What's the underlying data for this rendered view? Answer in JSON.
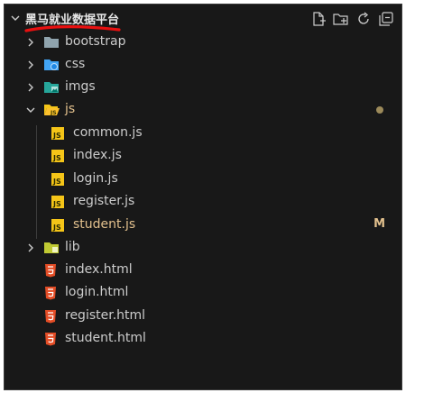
{
  "explorer": {
    "project_title": "黑马就业数据平台",
    "actions": [
      "new-file-icon",
      "new-folder-icon",
      "refresh-icon",
      "collapse-all-icon"
    ],
    "items": [
      {
        "label": "bootstrap",
        "kind": "folder",
        "expanded": false,
        "icon": "folder-icon"
      },
      {
        "label": "css",
        "kind": "folder",
        "expanded": false,
        "icon": "css-folder-icon"
      },
      {
        "label": "imgs",
        "kind": "folder",
        "expanded": false,
        "icon": "images-folder-icon"
      },
      {
        "label": "js",
        "kind": "folder",
        "expanded": true,
        "icon": "js-folder-icon",
        "status": "modified-dot"
      },
      {
        "label": "common.js",
        "kind": "file",
        "icon": "js-file-icon",
        "badge": "JS"
      },
      {
        "label": "index.js",
        "kind": "file",
        "icon": "js-file-icon",
        "badge": "JS"
      },
      {
        "label": "login.js",
        "kind": "file",
        "icon": "js-file-icon",
        "badge": "JS"
      },
      {
        "label": "register.js",
        "kind": "file",
        "icon": "js-file-icon",
        "badge": "JS"
      },
      {
        "label": "student.js",
        "kind": "file",
        "icon": "js-file-icon",
        "badge": "JS",
        "git_status": "M"
      },
      {
        "label": "lib",
        "kind": "folder",
        "expanded": false,
        "icon": "lib-folder-icon"
      },
      {
        "label": "index.html",
        "kind": "file",
        "icon": "html5-icon"
      },
      {
        "label": "login.html",
        "kind": "file",
        "icon": "html5-icon"
      },
      {
        "label": "register.html",
        "kind": "file",
        "icon": "html5-icon"
      },
      {
        "label": "student.html",
        "kind": "file",
        "icon": "html5-icon"
      }
    ]
  },
  "colors": {
    "background": "#181818",
    "text": "#cccccc",
    "modified": "#e2c08d",
    "annotation": "#e81010",
    "js_badge": "#f5c518",
    "html_badge": "#e44d26",
    "css_folder": "#42a5f5",
    "imgs_folder": "#26a69a",
    "js_folder": "#f5c518",
    "lib_folder": "#c0ca33",
    "folder": "#90a4ae"
  }
}
